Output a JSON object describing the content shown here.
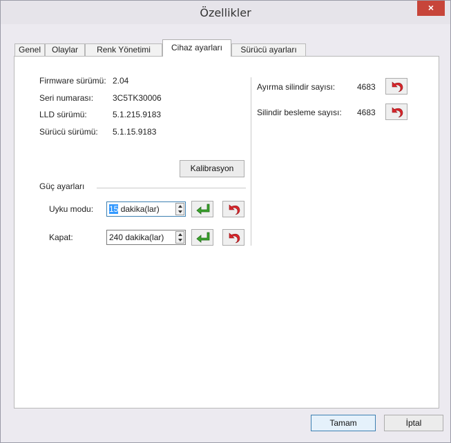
{
  "window": {
    "title": "Özellikler",
    "close_label": "×"
  },
  "tabs": [
    {
      "label": "Genel"
    },
    {
      "label": "Olaylar"
    },
    {
      "label": "Renk Yönetimi"
    },
    {
      "label": "Cihaz ayarları"
    },
    {
      "label": "Sürücü ayarları"
    }
  ],
  "active_tab": "Cihaz ayarları",
  "device_info": [
    {
      "label": "Firmware sürümü:",
      "value": "2.04"
    },
    {
      "label": "Seri numarası:",
      "value": "3C5TK30006"
    },
    {
      "label": "LLD sürümü:",
      "value": "5.1.215.9183"
    },
    {
      "label": "Sürücü sürümü:",
      "value": "5.1.15.9183"
    }
  ],
  "calibration_button": "Kalibrasyon",
  "power": {
    "group_label": "Güç ayarları",
    "sleep": {
      "label": "Uyku modu:",
      "value_selected": "15",
      "value_rest": " dakika(lar)"
    },
    "off": {
      "label": "Kapat:",
      "value": "240 dakika(lar)"
    }
  },
  "counters": [
    {
      "label": "Ayırma silindir sayısı:",
      "value": "4683"
    },
    {
      "label": "Silindir besleme sayısı:",
      "value": "4683"
    }
  ],
  "footer": {
    "ok": "Tamam",
    "cancel": "İptal"
  },
  "colors": {
    "accent": "#3c7fb1",
    "close_red": "#c7453a",
    "apply_green": "#3aa32c",
    "reset_red": "#d8262b"
  },
  "icons": {
    "apply": "enter-arrow-icon",
    "reset": "undo-arrow-icon"
  }
}
